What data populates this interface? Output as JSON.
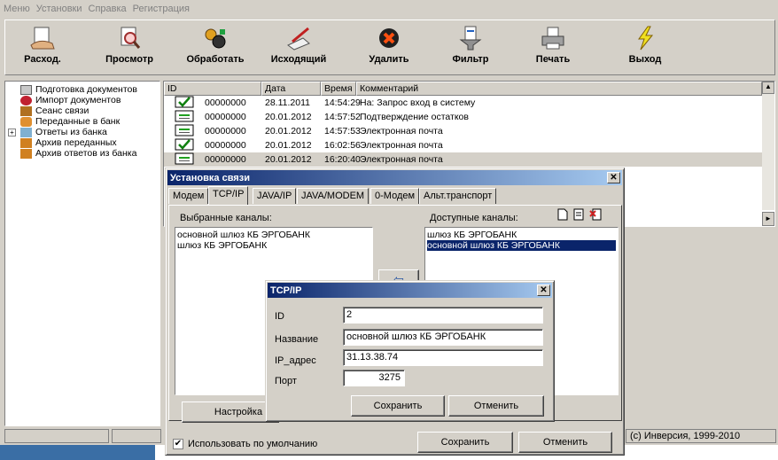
{
  "menu": [
    "Меню",
    "Установки",
    "Справка",
    "Регистрация"
  ],
  "toolbar": [
    {
      "label": "Расход.",
      "icon": "hand-document-icon"
    },
    {
      "label": "Просмотр",
      "icon": "magnifier-icon"
    },
    {
      "label": "Обработать",
      "icon": "gears-icon"
    },
    {
      "label": "Исходящий",
      "icon": "pen-paper-icon"
    },
    {
      "label": "Удалить",
      "icon": "delete-icon"
    },
    {
      "label": "Фильтр",
      "icon": "filter-icon"
    },
    {
      "label": "Печать",
      "icon": "printer-icon"
    },
    {
      "label": "Выход",
      "icon": "lightning-icon"
    }
  ],
  "tree": [
    {
      "label": "Подготовка документов",
      "icon": "folder-icon"
    },
    {
      "label": "Импорт документов",
      "icon": "import-icon"
    },
    {
      "label": "Сеанс связи",
      "icon": "session-icon"
    },
    {
      "label": "Переданные в банк",
      "icon": "sent-icon"
    },
    {
      "label": "Ответы из банка",
      "icon": "bank-answers-icon",
      "expander": "+"
    },
    {
      "label": "Архив переданных",
      "icon": "archive-icon"
    },
    {
      "label": "Архив ответов из банка",
      "icon": "archive-icon"
    }
  ],
  "list": {
    "columns": [
      "ID",
      "Дата",
      "Время",
      "Комментарий"
    ],
    "rows": [
      {
        "id": "00000000",
        "date": "28.11.2011",
        "time": "14:54:29",
        "comment": "На: Запрос вход в систему",
        "icon": "checked-doc-icon"
      },
      {
        "id": "00000000",
        "date": "20.01.2012",
        "time": "14:57:52",
        "comment": "Подтверждение остатков",
        "icon": "doc-icon"
      },
      {
        "id": "00000000",
        "date": "20.01.2012",
        "time": "14:57:53",
        "comment": "Электронная почта",
        "icon": "doc-icon"
      },
      {
        "id": "00000000",
        "date": "20.01.2012",
        "time": "16:02:56",
        "comment": "Электронная почта",
        "icon": "checked-doc-icon"
      },
      {
        "id": "00000000",
        "date": "20.01.2012",
        "time": "16:20:40",
        "comment": "Электронная почта",
        "icon": "doc-icon"
      }
    ]
  },
  "setup": {
    "title": "Установка связи",
    "tabs": [
      "Модем",
      "TCP/IP",
      "JAVA/IP",
      "JAVA/MODEM",
      "0-Модем",
      "Альт.транспорт"
    ],
    "selected_label": "Выбранные каналы:",
    "available_label": "Доступные каналы:",
    "selected": [
      "основной шлюз КБ ЭРГОБАНК",
      "шлюз КБ ЭРГОБАНК"
    ],
    "available": [
      "шлюз КБ ЭРГОБАНК",
      "основной шлюз КБ ЭРГОБАНК"
    ],
    "settings_button": "Настройка",
    "default_checkbox": "Использовать по умолчанию",
    "save": "Сохранить",
    "cancel": "Отменить"
  },
  "tcp": {
    "title": "TCP/IP",
    "id_label": "ID",
    "id_value": "2",
    "name_label": "Название",
    "name_value": "основной шлюз КБ ЭРГОБАНК",
    "ip_label": "IP_адрес",
    "ip_value": "31.13.38.74",
    "port_label": "Порт",
    "port_value": "3275",
    "save": "Сохранить",
    "cancel": "Отменить"
  },
  "status": {
    "copyright": "(с) Инверсия, 1999-2010"
  },
  "colors": {
    "selection": "#0a246a",
    "title_start": "#0a246a",
    "title_end": "#a6caf0"
  }
}
